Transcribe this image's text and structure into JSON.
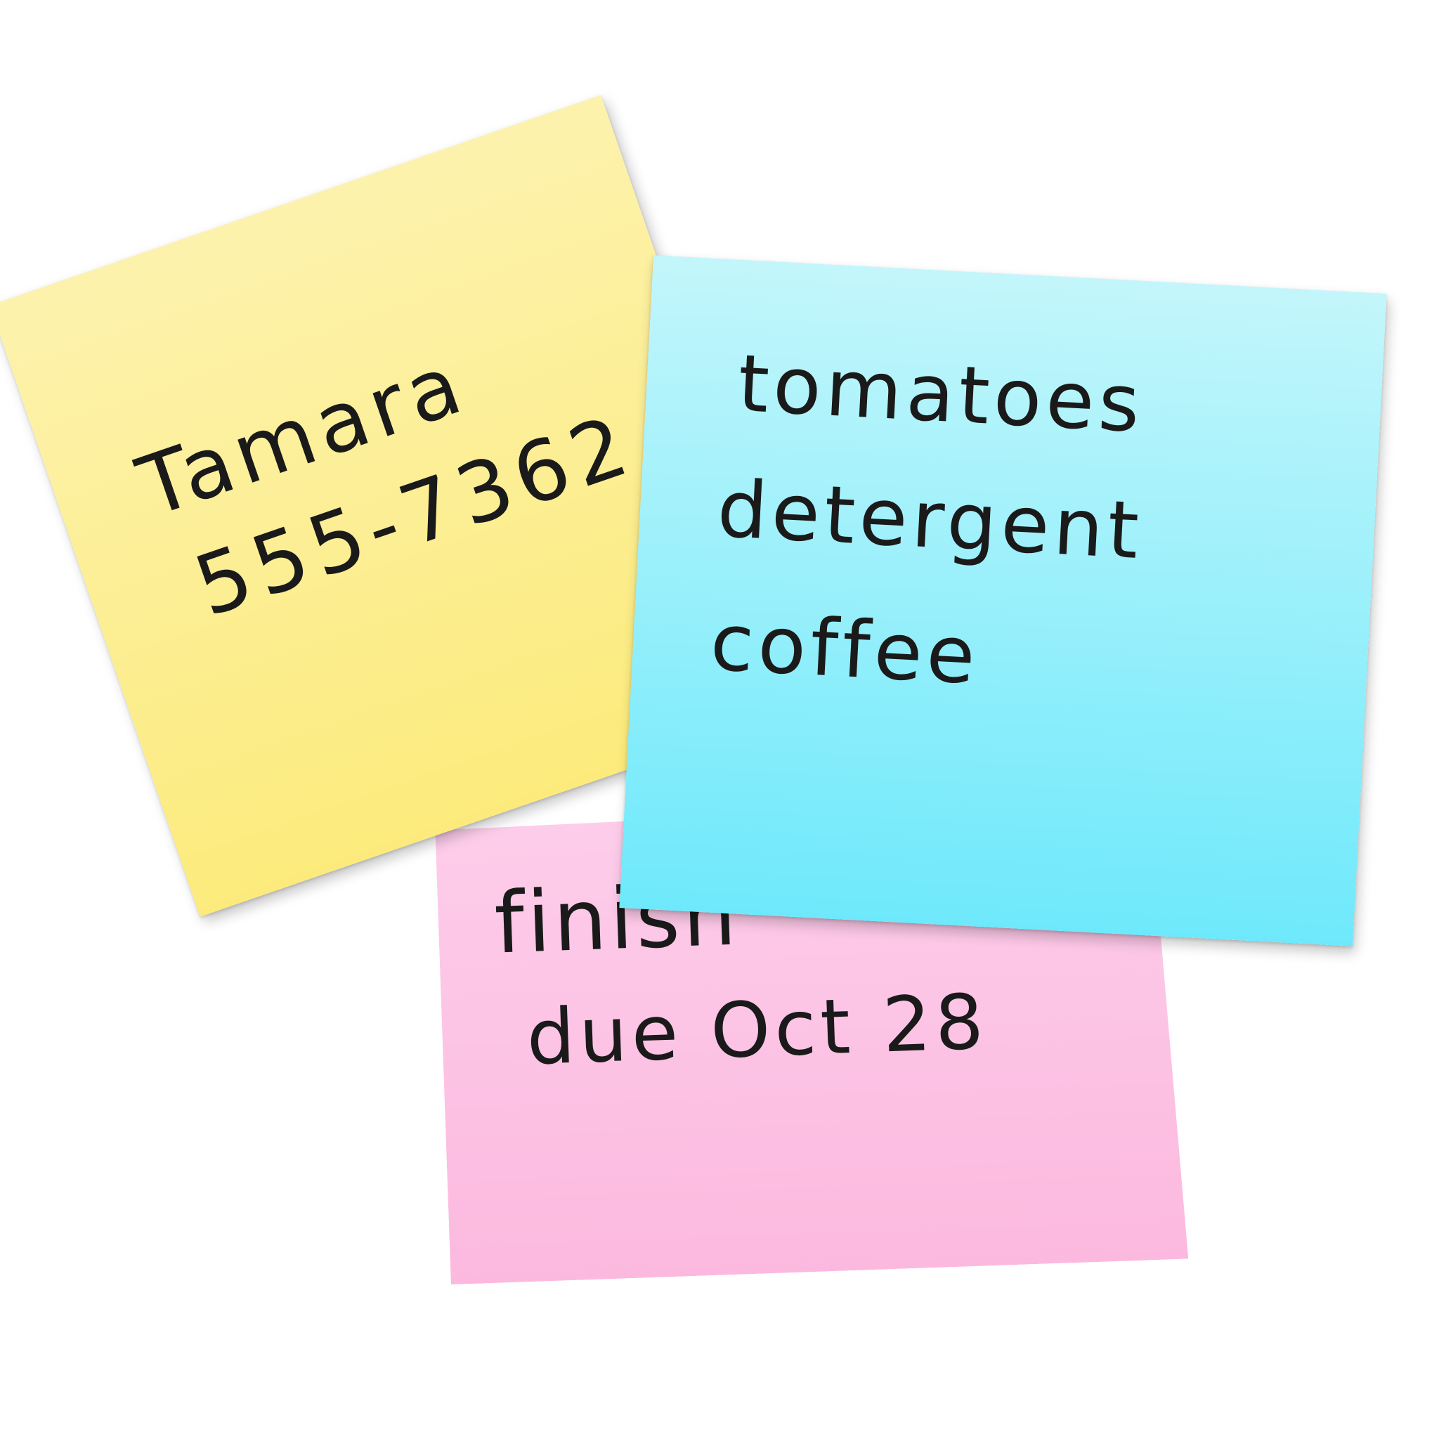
{
  "notes": {
    "pink": {
      "color": "#fcc4e4",
      "lines": [
        "finish",
        "due Oct 28"
      ]
    },
    "yellow": {
      "color": "#fcef92",
      "lines": [
        "Tamara",
        "555-7362"
      ]
    },
    "blue": {
      "color": "#9cf1fb",
      "lines": [
        "tomatoes",
        "detergent",
        "coffee"
      ]
    }
  }
}
